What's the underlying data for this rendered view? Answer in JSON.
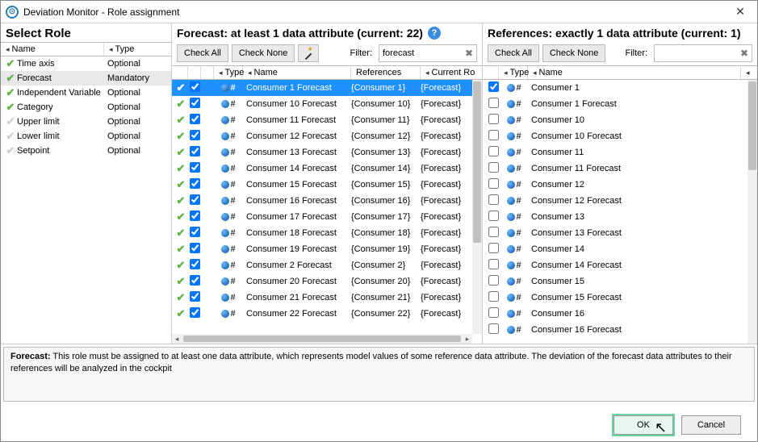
{
  "window": {
    "title": "Deviation Monitor - Role assignment"
  },
  "left": {
    "heading": "Select Role",
    "col_name": "Name",
    "col_type": "Type",
    "roles": [
      {
        "tick": "green",
        "name": "Time axis",
        "type": "Optional"
      },
      {
        "tick": "green",
        "name": "Forecast",
        "type": "Mandatory",
        "selected": true
      },
      {
        "tick": "green",
        "name": "Independent Variable",
        "type": "Optional"
      },
      {
        "tick": "green",
        "name": "Category",
        "type": "Optional"
      },
      {
        "tick": "gray",
        "name": "Upper limit",
        "type": "Optional"
      },
      {
        "tick": "gray",
        "name": "Lower limit",
        "type": "Optional"
      },
      {
        "tick": "gray",
        "name": "Setpoint",
        "type": "Optional"
      }
    ]
  },
  "mid": {
    "title": "Forecast: at least 1 data attribute (current: 22)",
    "check_all": "Check All",
    "check_none": "Check None",
    "filter_label": "Filter:",
    "filter_value": "forecast",
    "cols": {
      "type": "Type",
      "name": "Name",
      "refs": "References",
      "cur": "Current Ro"
    },
    "rows": [
      {
        "name": "Consumer 1 Forecast",
        "ref": "{Consumer 1}",
        "cur": "{Forecast}",
        "selected": true
      },
      {
        "name": "Consumer 10 Forecast",
        "ref": "{Consumer 10}",
        "cur": "{Forecast}"
      },
      {
        "name": "Consumer 11 Forecast",
        "ref": "{Consumer 11}",
        "cur": "{Forecast}"
      },
      {
        "name": "Consumer 12 Forecast",
        "ref": "{Consumer 12}",
        "cur": "{Forecast}"
      },
      {
        "name": "Consumer 13 Forecast",
        "ref": "{Consumer 13}",
        "cur": "{Forecast}"
      },
      {
        "name": "Consumer 14 Forecast",
        "ref": "{Consumer 14}",
        "cur": "{Forecast}"
      },
      {
        "name": "Consumer 15 Forecast",
        "ref": "{Consumer 15}",
        "cur": "{Forecast}"
      },
      {
        "name": "Consumer 16 Forecast",
        "ref": "{Consumer 16}",
        "cur": "{Forecast}"
      },
      {
        "name": "Consumer 17 Forecast",
        "ref": "{Consumer 17}",
        "cur": "{Forecast}"
      },
      {
        "name": "Consumer 18 Forecast",
        "ref": "{Consumer 18}",
        "cur": "{Forecast}"
      },
      {
        "name": "Consumer 19 Forecast",
        "ref": "{Consumer 19}",
        "cur": "{Forecast}"
      },
      {
        "name": "Consumer 2 Forecast",
        "ref": "{Consumer 2}",
        "cur": "{Forecast}"
      },
      {
        "name": "Consumer 20 Forecast",
        "ref": "{Consumer 20}",
        "cur": "{Forecast}"
      },
      {
        "name": "Consumer 21 Forecast",
        "ref": "{Consumer 21}",
        "cur": "{Forecast}"
      },
      {
        "name": "Consumer 22 Forecast",
        "ref": "{Consumer 22}",
        "cur": "{Forecast}"
      }
    ]
  },
  "right": {
    "title": "References: exactly 1 data attribute (current: 1)",
    "check_all": "Check All",
    "check_none": "Check None",
    "filter_label": "Filter:",
    "filter_value": "",
    "cols": {
      "type": "Type",
      "name": "Name"
    },
    "rows": [
      {
        "name": "Consumer 1",
        "checked": true
      },
      {
        "name": "Consumer 1 Forecast"
      },
      {
        "name": "Consumer 10"
      },
      {
        "name": "Consumer 10 Forecast"
      },
      {
        "name": "Consumer 11"
      },
      {
        "name": "Consumer 11 Forecast"
      },
      {
        "name": "Consumer 12"
      },
      {
        "name": "Consumer 12 Forecast"
      },
      {
        "name": "Consumer 13"
      },
      {
        "name": "Consumer 13 Forecast"
      },
      {
        "name": "Consumer 14"
      },
      {
        "name": "Consumer 14 Forecast"
      },
      {
        "name": "Consumer 15"
      },
      {
        "name": "Consumer 15 Forecast"
      },
      {
        "name": "Consumer 16"
      },
      {
        "name": "Consumer 16 Forecast"
      }
    ]
  },
  "description": {
    "label": "Forecast:",
    "text": "This role must be assigned to at least one data attribute, which represents model values of some reference data attribute. The deviation of the forecast data attributes to their references will be analyzed in the cockpit"
  },
  "footer": {
    "ok": "OK",
    "cancel": "Cancel"
  }
}
